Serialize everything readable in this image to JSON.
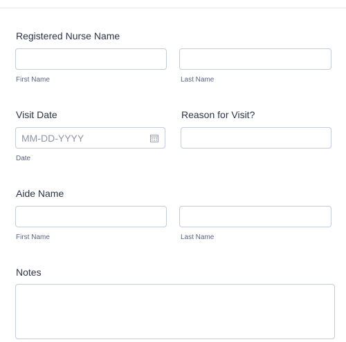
{
  "form": {
    "nurse": {
      "label": "Registered Nurse Name",
      "first_value": "",
      "last_value": "",
      "first_sublabel": "First Name",
      "last_sublabel": "Last Name"
    },
    "visit_date": {
      "label": "Visit Date",
      "placeholder": "MM-DD-YYYY",
      "value": "",
      "sublabel": "Date",
      "icon": "calendar-icon"
    },
    "reason": {
      "label": "Reason for Visit?",
      "value": ""
    },
    "aide": {
      "label": "Aide Name",
      "first_value": "",
      "last_value": "",
      "first_sublabel": "First Name",
      "last_sublabel": "Last Name"
    },
    "notes": {
      "label": "Notes",
      "value": ""
    }
  },
  "colors": {
    "label": "#2c3345",
    "sublabel": "#57647e",
    "border": "#c3cad8",
    "placeholder": "#8f96a3"
  }
}
